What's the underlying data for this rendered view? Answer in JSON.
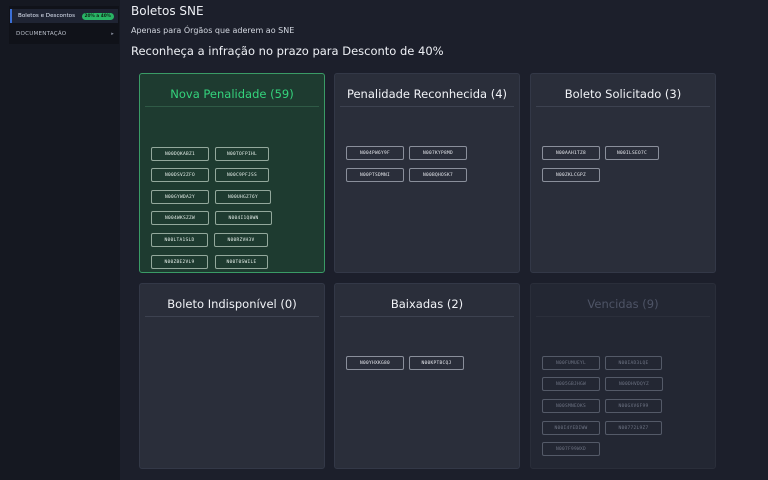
{
  "sidebar": {
    "active_item": {
      "label": "Boletos e Descontos",
      "badge": "20% a 40%"
    },
    "doc_item": {
      "label": "DOCUMENTAÇÃO",
      "caret": "▸"
    }
  },
  "page": {
    "title": "Boletos SNE",
    "subtitle": "Apenas para Órgãos que aderem ao SNE",
    "headline": "Reconheça a infração no prazo para Desconto de 40%"
  },
  "cards": [
    {
      "title": "Nova Penalidade (59)",
      "chips": [
        "N00DQKABZ1",
        "N00TOFPIHL",
        "N00DSV2ZFO",
        "N00C9PFJSS",
        "N00GYWDA2Y",
        "N00UHGZ76Y",
        "N004WKSZZW",
        "N004I1Q8WN",
        "N00LTA1SLD",
        "N00RZVH3V",
        "N00ZBE2VL9",
        "N00T0SWILE"
      ]
    },
    {
      "title": "Penalidade Reconhecida (4)",
      "chips": [
        "N004PW6Y9F",
        "N007KYP8MD",
        "N00PTSDMNI",
        "N00BQHOSK7"
      ]
    },
    {
      "title": "Boleto Solicitado (3)",
      "chips": [
        "N00AAH1TZ8",
        "N00ILSEO7C",
        "N00ZKLCGPZ"
      ]
    },
    {
      "title": "Boleto Indisponível (0)",
      "chips": []
    },
    {
      "title": "Baixadas (2)",
      "chips": [
        "N00YHXKG80",
        "N00KPTBCQJ"
      ]
    },
    {
      "title": "Vencidas (9)",
      "chips": [
        "N00FUMUEYL",
        "N00IAD3LQE",
        "N005GBJHGW",
        "N00DHVDQYZ",
        "N00SMNEOKS",
        "N00GXV6F99",
        "N00I4YEDIWW",
        "N00772L9Z7",
        "N007F99WXD"
      ]
    }
  ]
}
